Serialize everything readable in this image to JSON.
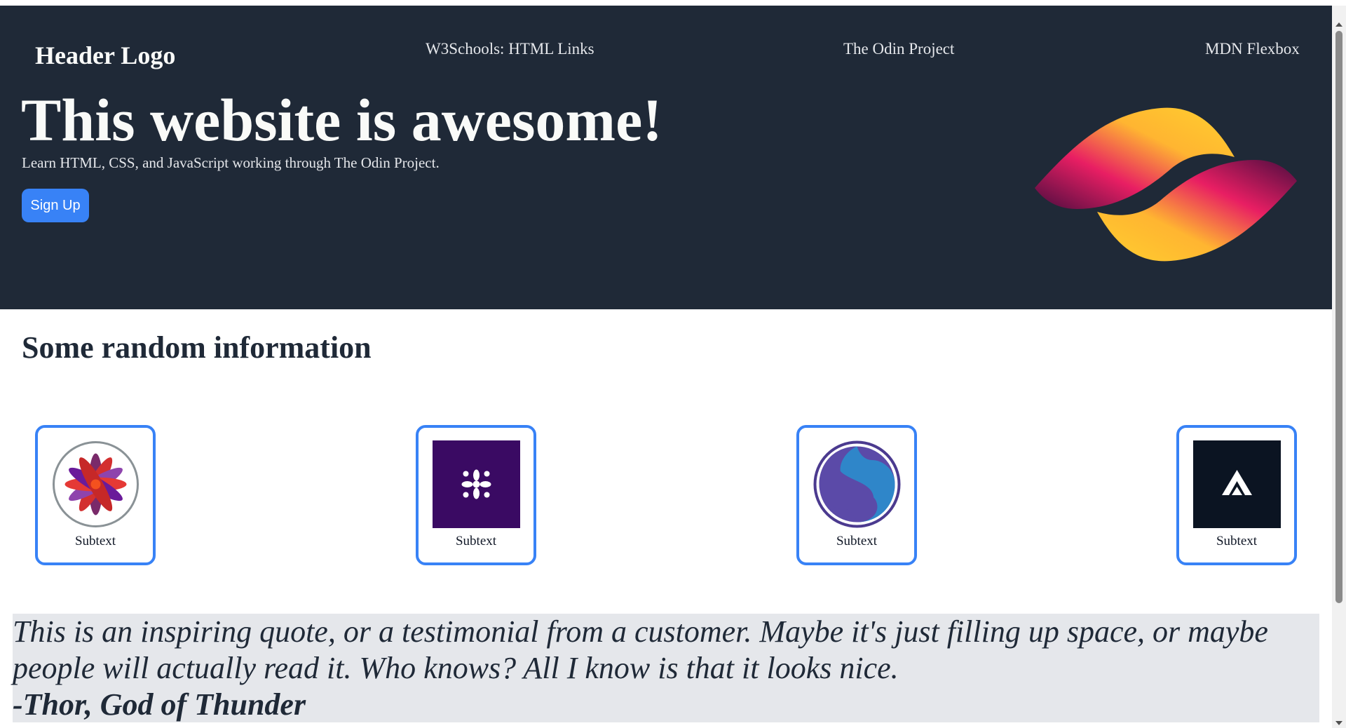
{
  "header": {
    "logo": "Header Logo",
    "links": [
      "W3Schools: HTML Links",
      "The Odin Project",
      "MDN Flexbox"
    ]
  },
  "hero": {
    "title": "This website is awesome!",
    "subtitle": "Learn HTML, CSS, and JavaScript working through The Odin Project.",
    "button_label": "Sign Up"
  },
  "info": {
    "title": "Some random information",
    "cards": [
      {
        "caption": "Subtext",
        "icon": "lotus-logo-icon"
      },
      {
        "caption": "Subtext",
        "icon": "purple-flower-logo-icon"
      },
      {
        "caption": "Subtext",
        "icon": "swirl-s-logo-icon"
      },
      {
        "caption": "Subtext",
        "icon": "chevron-arrow-logo-icon"
      }
    ]
  },
  "quote": {
    "text": "This is an inspiring quote, or a testimonial from a customer. Maybe it's just filling up space, or maybe people will actually read it. Who knows? All I know is that it looks nice.",
    "author": "-Thor, God of Thunder"
  },
  "colors": {
    "hero_bg": "#1f2937",
    "accent": "#3882f6",
    "quote_bg": "#e5e7eb"
  }
}
